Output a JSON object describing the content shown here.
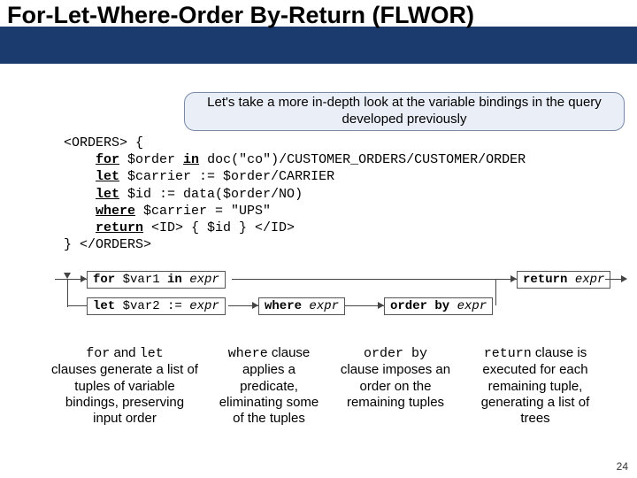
{
  "title": "For-Let-Where-Order By-Return (FLWOR)",
  "intro": "Let's take a more in-depth look at the variable bindings in the query developed previously",
  "code": {
    "l1a": "<ORDERS> {",
    "l2_for": "for",
    "l2_rest": " $order ",
    "l2_in": "in",
    "l2_tail": " doc(\"co\")/CUSTOMER_ORDERS/CUSTOMER/ORDER",
    "l3_let": "let",
    "l3_rest": " $carrier := $order/CARRIER",
    "l4_let": "let",
    "l4_rest": " $id := data($order/NO)",
    "l5_where": "where",
    "l5_rest": " $carrier = \"UPS\"",
    "l6_return": "return",
    "l6_rest": " <ID> { $id } </ID>",
    "l7": "} </ORDERS>"
  },
  "diagram": {
    "for_kw": "for",
    "for_rest": " $var1 ",
    "for_in": "in",
    "for_expr": " expr",
    "let_kw": "let",
    "let_rest": " $var2 := ",
    "let_expr": "expr",
    "where_kw": "where",
    "where_expr": " expr",
    "order_kw": "order by",
    "order_expr": " expr",
    "return_kw": "return",
    "return_expr": " expr"
  },
  "explain": {
    "c1": {
      "m1": "for",
      "t1": " and ",
      "m2": "let",
      "rest": "clauses generate a list of tuples of variable bindings, preserving input order"
    },
    "c2": {
      "m": "where",
      "t1": " clause applies a predicate, eliminating some of the tuples"
    },
    "c3": {
      "m": "order by",
      "t1": "clause imposes an order on the remaining tuples"
    },
    "c4": {
      "m": "return",
      "t1": " clause is executed for each remaining tuple, generating a list of trees"
    }
  },
  "slide_number": "24"
}
